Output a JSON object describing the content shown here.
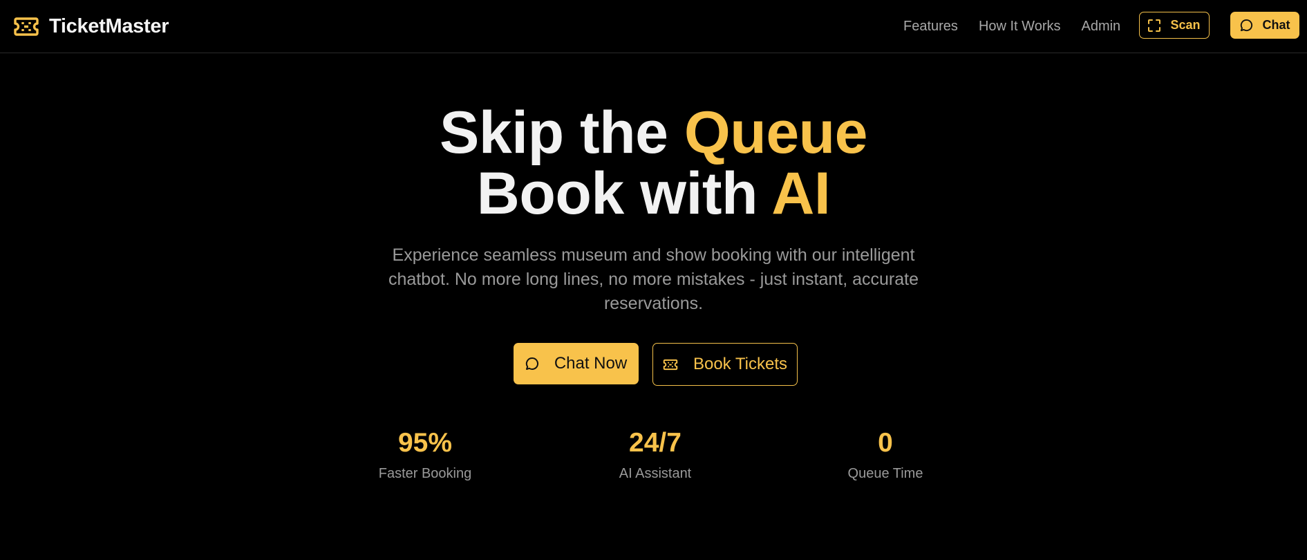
{
  "brand": {
    "name": "TicketMaster",
    "icon": "ticket-icon"
  },
  "nav": {
    "links": [
      "Features",
      "How It Works",
      "Admin"
    ],
    "scan_label": "Scan",
    "chat_label": "Chat"
  },
  "hero": {
    "line1_prefix": "Skip the ",
    "line1_accent": "Queue",
    "line2_prefix": "Book with ",
    "line2_accent": "AI",
    "subtitle": "Experience seamless museum and show booking with our intelligent chatbot. No more long lines, no more mistakes - just instant, accurate reservations.",
    "cta_primary": "Chat Now",
    "cta_secondary": "Book Tickets"
  },
  "stats": [
    {
      "value": "95%",
      "label": "Faster Booking"
    },
    {
      "value": "24/7",
      "label": "AI Assistant"
    },
    {
      "value": "0",
      "label": "Queue Time"
    }
  ],
  "colors": {
    "accent": "#f8c24b",
    "background": "#000000",
    "muted": "#9a9a9a"
  }
}
